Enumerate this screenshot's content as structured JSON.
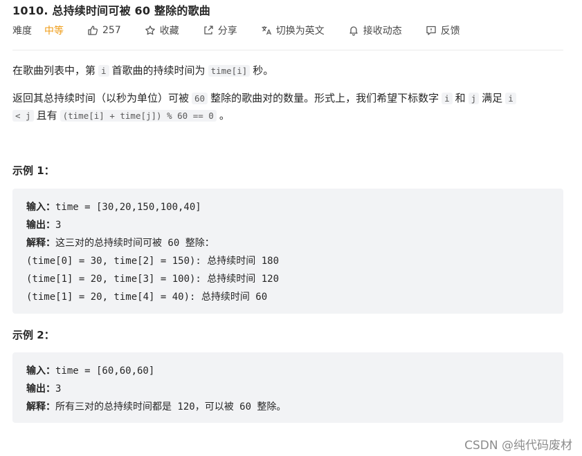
{
  "problem": {
    "title": "1010. 总持续时间可被 60 整除的歌曲"
  },
  "meta": {
    "difficulty_label": "难度",
    "difficulty_value": "中等",
    "like_count": "257",
    "favorite_label": "收藏",
    "share_label": "分享",
    "switch_lang_label": "切换为英文",
    "subscribe_label": "接收动态",
    "feedback_label": "反馈"
  },
  "description": {
    "p1_a": "在歌曲列表中，第",
    "p1_code": "i",
    "p1_b": "首歌曲的持续时间为",
    "p1_code2": "time[i]",
    "p1_c": "秒。",
    "p2_a": "返回其总持续时间（以秒为单位）可被",
    "p2_code": "60",
    "p2_b": "整除的歌曲对的数量。形式上，我们希望下标数字",
    "p2_code2": "i",
    "p2_c": "和",
    "p2_code3": "j",
    "p2_d": "满足",
    "p2_code4": "i",
    "p2_code5": "< j",
    "p2_e": "且有",
    "p2_code6": "(time[i] + time[j]) % 60 == 0",
    "p2_f": "。"
  },
  "examples": [
    {
      "title": "示例 1：",
      "input_label": "输入：",
      "input_value": "time = [30,20,150,100,40]",
      "output_label": "输出：",
      "output_value": "3",
      "explain_label": "解释：",
      "explain_value": "这三对的总持续时间可被 60 整除：",
      "extra_lines": [
        "(time[0] = 30, time[2] = 150): 总持续时间 180",
        "(time[1] = 20, time[3] = 100): 总持续时间 120",
        "(time[1] = 20, time[4] = 40): 总持续时间 60"
      ]
    },
    {
      "title": "示例 2：",
      "input_label": "输入：",
      "input_value": "time = [60,60,60]",
      "output_label": "输出：",
      "output_value": "3",
      "explain_label": "解释：",
      "explain_value": "所有三对的总持续时间都是 120，可以被 60 整除。"
    }
  ],
  "watermark": "CSDN @纯代码废材",
  "colors": {
    "difficulty_medium": "#ef9a12",
    "code_bg": "#f2f3f5"
  }
}
